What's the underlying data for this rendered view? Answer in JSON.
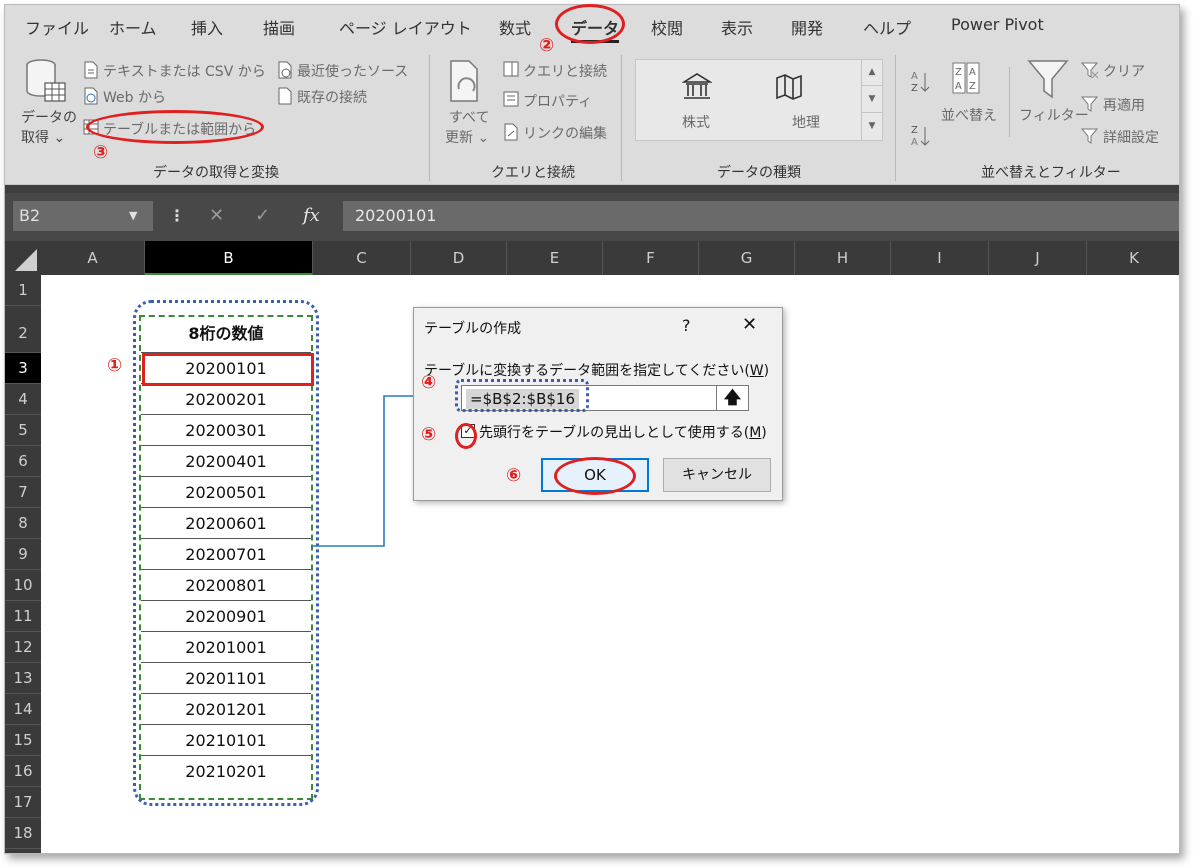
{
  "tabs": [
    "ファイル",
    "ホーム",
    "挿入",
    "描画",
    "ページ レイアウト",
    "数式",
    "データ",
    "校閲",
    "表示",
    "開発",
    "ヘルプ",
    "Power Pivot"
  ],
  "active_tab": "データ",
  "ribbon": {
    "get_data": {
      "get_data_l1": "データの",
      "get_data_l2": "取得 ⌄",
      "text_csv": "テキストまたは CSV から",
      "web": "Web から",
      "table_range": "テーブルまたは範囲から",
      "recent_sources": "最近使ったソース",
      "existing_connections": "既存の接続",
      "label": "データの取得と変換"
    },
    "queries": {
      "refresh_l1": "すべて",
      "refresh_l2": "更新 ⌄",
      "queries_connections": "クエリと接続",
      "properties": "プロパティ",
      "edit_links": "リンクの編集",
      "label": "クエリと接続"
    },
    "data_types": {
      "stocks": "株式",
      "geography": "地理",
      "label": "データの種類"
    },
    "sort_filter": {
      "sort": "並べ替え",
      "filter": "フィルター",
      "clear": "クリア",
      "reapply": "再適用",
      "advanced": "詳細設定",
      "label": "並べ替えとフィルター"
    }
  },
  "formula_bar": {
    "name_box": "B2",
    "fx": "fx",
    "value": "20200101"
  },
  "columns": [
    "A",
    "B",
    "C",
    "D",
    "E",
    "F",
    "G",
    "H",
    "I",
    "J",
    "K"
  ],
  "selected_column": "B",
  "rows": [
    "1",
    "2",
    "3",
    "4",
    "5",
    "6",
    "7",
    "8",
    "9",
    "10",
    "11",
    "12",
    "13",
    "14",
    "15",
    "16",
    "17",
    "18"
  ],
  "selected_row": "3",
  "table": {
    "header": "8桁の数値",
    "values": [
      "20200101",
      "20200201",
      "20200301",
      "20200401",
      "20200501",
      "20200601",
      "20200701",
      "20200801",
      "20200901",
      "20201001",
      "20201101",
      "20201201",
      "20210101",
      "20210201"
    ]
  },
  "dialog": {
    "title": "テーブルの作成",
    "help": "?",
    "close": "✕",
    "prompt": "テーブルに変換するデータ範囲を指定してください(",
    "prompt_key": "W",
    "prompt_end": ")",
    "range": "=$B$2:$B$16",
    "range_button": "🡅",
    "checkbox_checked": true,
    "checkbox_label": "先頭行をテーブルの見出しとして使用する(",
    "checkbox_key": "M",
    "checkbox_end": ")",
    "ok": "OK",
    "cancel": "キャンセル"
  },
  "annotations": {
    "n1": "①",
    "n2": "②",
    "n3": "③",
    "n4": "④",
    "n5": "⑤",
    "n6": "⑥",
    "color": "#e02020"
  }
}
